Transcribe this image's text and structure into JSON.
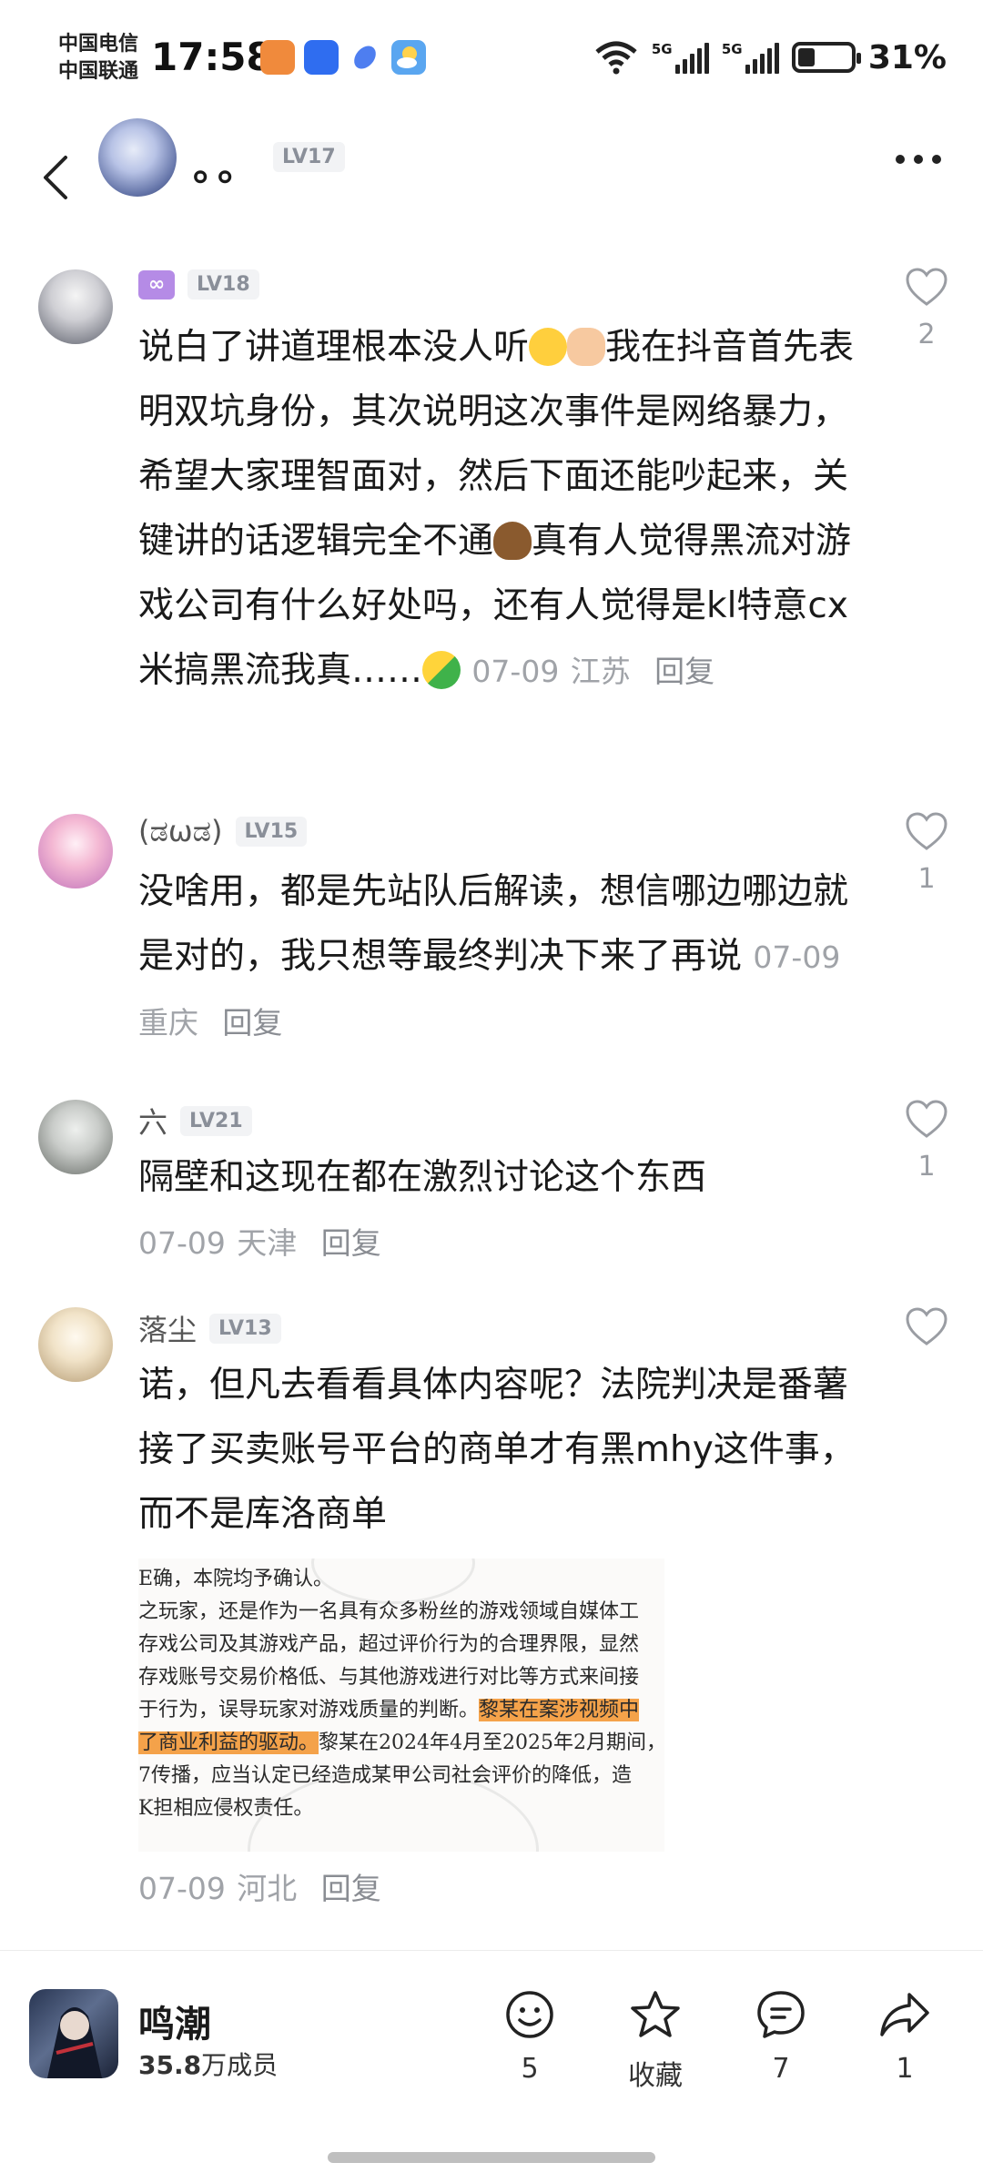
{
  "status_bar": {
    "carrier1": "中国电信",
    "carrier2": "中国联通",
    "time": "17:58",
    "net1": "5G",
    "net2": "5G",
    "battery": "31%"
  },
  "header": {
    "title": "。。",
    "level": "LV17"
  },
  "comments": [
    {
      "username": "",
      "level": "LV18",
      "text": "说白了讲道理根本没人听",
      "text2": "我在抖音首先表明双坑身份，其次说明这次事件是网络暴力，希望大家理智面对，然后下面还能吵起来，关键讲的话逻辑完全不通",
      "text3": "真有人觉得黑流对游戏公司有什么好处吗，还有人觉得是kl特意cx米搞黑流我真……",
      "date": "07-09",
      "location": "江苏",
      "reply": "回复",
      "likes": "2"
    },
    {
      "username": "(ಡωಡ)",
      "level": "LV15",
      "text": "没啥用，都是先站队后解读，想信哪边哪边就是对的，我只想等最终判决下来了再说",
      "date": "07-09",
      "location": "重庆",
      "reply": "回复",
      "likes": "1"
    },
    {
      "username": "六",
      "level": "LV21",
      "text": "隔壁和这现在都在激烈讨论这个东西",
      "date": "07-09",
      "location": "天津",
      "reply": "回复",
      "likes": "1"
    },
    {
      "username": "落尘",
      "level": "LV13",
      "text": "诺，但凡去看看具体内容呢？法院判决是番薯接了买卖账号平台的商单才有黑mhy这件事，而不是库洛商单",
      "date": "07-09",
      "location": "河北",
      "reply": "回复",
      "likes": ""
    }
  ],
  "document_image": {
    "lines": [
      "E确，本院均予确认。",
      "之玩家，还是作为一名具有众多粉丝的游戏领域自媒体工",
      "存戏公司及其游戏产品，超过评价行为的合理界限，显然",
      "存戏账号交易价格低、与其他游戏进行对比等方式来间接",
      "于行为，误导玩家对游戏质量的判断。",
      "黎某在案涉视频中",
      "了商业利益的驱动。",
      "黎某在2024年4月至2025年2月期间，",
      "7传播，应当认定已经造成某甲公司社会评价的降低，造",
      "K担相应侵权责任。"
    ]
  },
  "bottom_bar": {
    "community_name": "鸣潮",
    "member_count": "35.8",
    "member_suffix": "万成员",
    "emoji_count": "5",
    "favorite_label": "收藏",
    "comment_count": "7",
    "share_count": "1"
  },
  "colors": {
    "highlight": "#f4a24a",
    "level_bg": "#f2f3f5",
    "meta_gray": "#a0a3a8"
  }
}
